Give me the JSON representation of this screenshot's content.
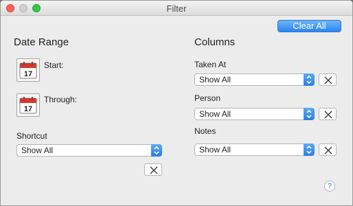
{
  "window": {
    "title": "Filter"
  },
  "toolbar": {
    "clear_all": "Clear All"
  },
  "date_range": {
    "title": "Date Range",
    "start_label": "Start:",
    "through_label": "Through:",
    "calendar_day": "17",
    "shortcut_label": "Shortcut",
    "shortcut_value": "Show All"
  },
  "columns": {
    "title": "Columns",
    "items": [
      {
        "label": "Taken At",
        "value": "Show All"
      },
      {
        "label": "Person",
        "value": "Show All"
      },
      {
        "label": "Notes",
        "value": "Show All"
      }
    ]
  },
  "help": {
    "glyph": "?"
  },
  "colors": {
    "accent": "#2a86f1",
    "close": "#fc605c",
    "zoom": "#34c84a"
  }
}
